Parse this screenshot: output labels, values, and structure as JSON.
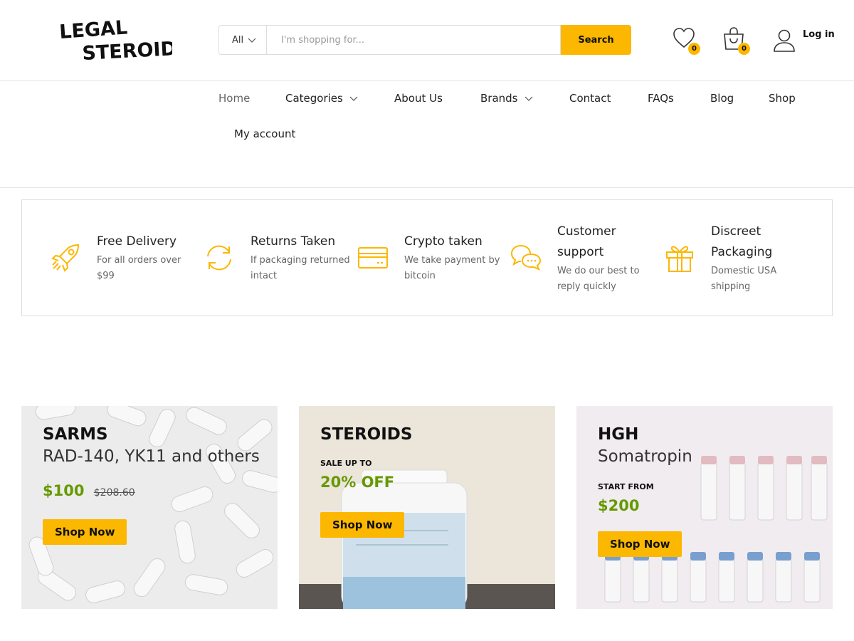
{
  "header": {
    "logo_text_line1": "LEGAL",
    "logo_text_line2": "STEROIDS",
    "category_select_value": "All",
    "search_placeholder": "I'm shopping for...",
    "search_button_label": "Search",
    "wishlist_count": "0",
    "cart_count": "0",
    "login_label": "Log in"
  },
  "nav": {
    "items": [
      {
        "label": "Home",
        "icon": null
      },
      {
        "label": "Categories",
        "icon": "chevron-down-icon"
      },
      {
        "label": "About Us",
        "icon": null
      },
      {
        "label": "Brands",
        "icon": "chevron-down-icon"
      },
      {
        "label": "Contact",
        "icon": null
      },
      {
        "label": "FAQs",
        "icon": null
      },
      {
        "label": "Blog",
        "icon": null
      },
      {
        "label": "Shop",
        "icon": null
      },
      {
        "label": "My account",
        "icon": null
      }
    ]
  },
  "features": [
    {
      "title": "Free Delivery",
      "desc": "For all orders over $99",
      "icon": "rocket-icon"
    },
    {
      "title": "Returns Taken",
      "desc": "If packaging returned intact",
      "icon": "refresh-icon"
    },
    {
      "title": "Crypto taken",
      "desc": "We take payment by bitcoin",
      "icon": "credit-card-icon"
    },
    {
      "title": "Customer support",
      "desc": "We do our best to reply quickly",
      "icon": "chat-bubbles-icon"
    },
    {
      "title": "Discreet Packaging",
      "desc": "Domestic USA shipping",
      "icon": "gift-icon"
    }
  ],
  "promos": [
    {
      "title": "SARMS",
      "subtitle": "RAD-140, YK11 and others",
      "price": "$100",
      "old_price": "$208.60",
      "button": "Shop Now"
    },
    {
      "title": "STEROIDS",
      "small_label": "SALE UP TO",
      "highlight": "20% OFF",
      "button": "Shop Now"
    },
    {
      "title": "HGH",
      "subtitle": "Somatropin",
      "small_label": "START FROM",
      "price": "$200",
      "button": "Shop Now"
    }
  ],
  "colors": {
    "accent": "#fcb700",
    "price_green": "#669900",
    "icon_accent": "#fcb700"
  }
}
